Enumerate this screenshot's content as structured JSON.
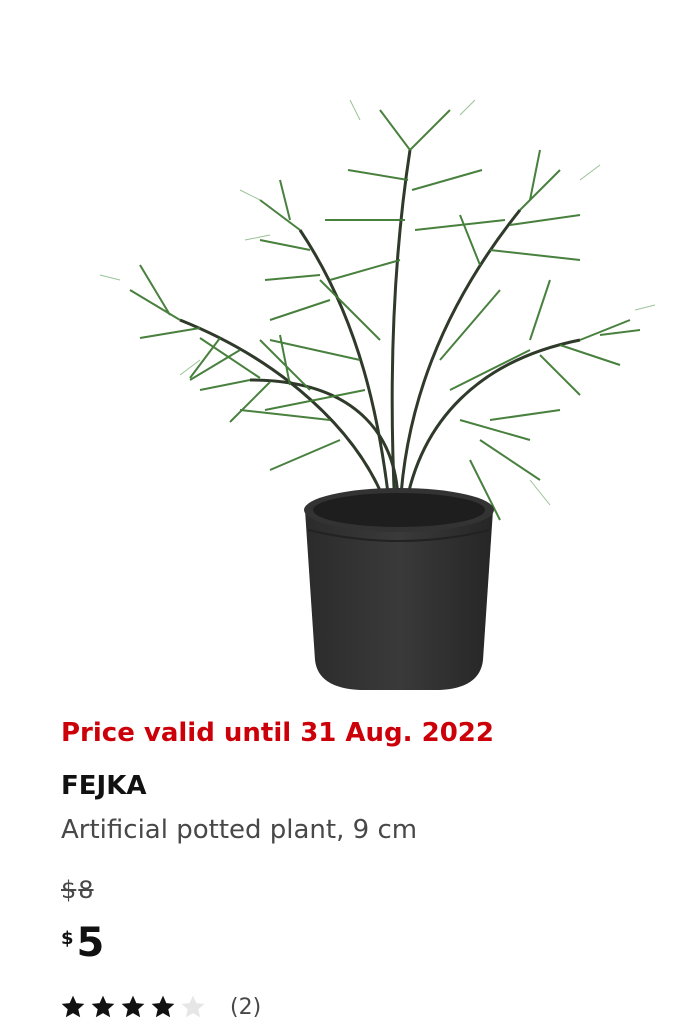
{
  "product": {
    "price_validity": "Price valid until 31 Aug. 2022",
    "name": "FEJKA",
    "description": "Artificial potted plant, 9 cm",
    "old_price": {
      "currency": "$",
      "amount": "8"
    },
    "price": {
      "currency": "$",
      "amount": "5"
    },
    "rating": {
      "stars_filled": 4,
      "stars_total": 5,
      "review_count": "(2)"
    },
    "image": {
      "subject": "artificial potted asparagus fern plant in black pot"
    }
  },
  "colors": {
    "validity_red": "#cc0008",
    "text_dark": "#111111",
    "text_muted": "#484848",
    "star_filled": "#111111",
    "star_empty": "#e6e6e6"
  }
}
